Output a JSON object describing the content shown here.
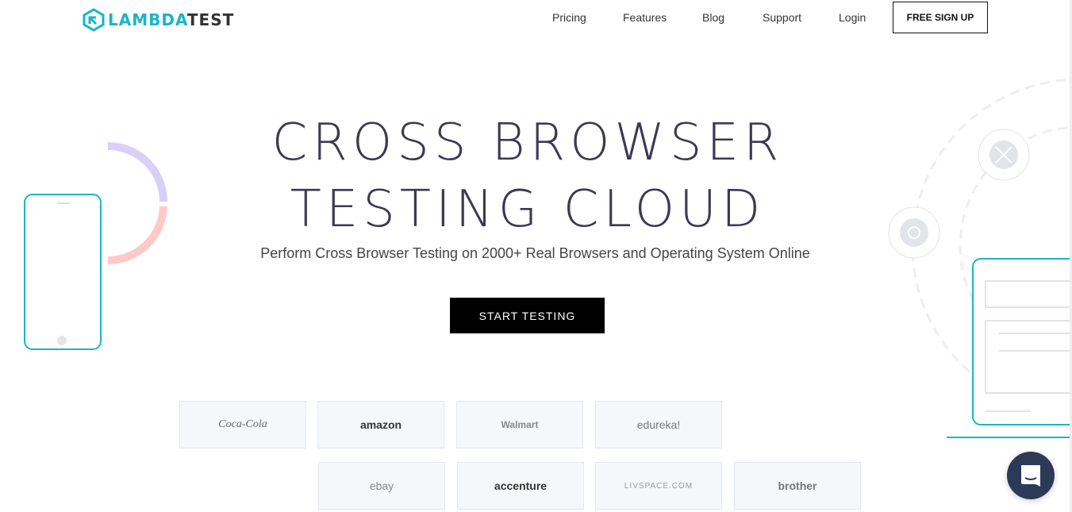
{
  "header": {
    "logo": {
      "part1": "LAMBDA",
      "part2": "TEST"
    },
    "nav": [
      {
        "label": "Pricing"
      },
      {
        "label": "Features"
      },
      {
        "label": "Blog"
      },
      {
        "label": "Support"
      },
      {
        "label": "Login"
      }
    ],
    "signup_label": "FREE SIGN UP"
  },
  "hero": {
    "title_line1": "CROSS BROWSER",
    "title_line2": "TESTING CLOUD",
    "subtitle": "Perform Cross Browser Testing on 2000+ Real Browsers and Operating System Online",
    "cta_label": "START TESTING"
  },
  "clients": [
    {
      "name": "Coca-Cola"
    },
    {
      "name": "amazon"
    },
    {
      "name": "Walmart"
    },
    {
      "name": "edureka!"
    },
    {
      "name": "ebay"
    },
    {
      "name": "accenture"
    },
    {
      "name": "LIVSPACE.COM"
    },
    {
      "name": "brother"
    }
  ],
  "colors": {
    "brand": "#18b6c6",
    "title": "#3b3a50",
    "chat": "#2c3a57"
  },
  "icons": [
    "chrome-icon",
    "safari-icon",
    "chat-icon"
  ]
}
